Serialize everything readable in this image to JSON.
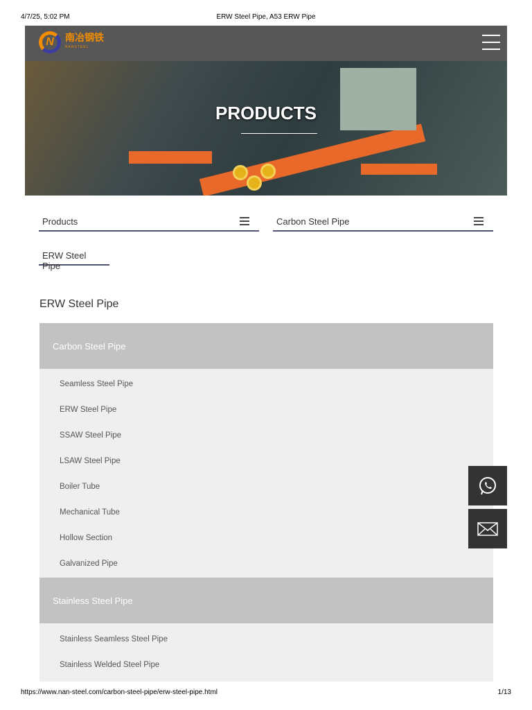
{
  "print_header": {
    "datetime": "4/7/25, 5:02 PM",
    "title": "ERW Steel Pipe, A53 ERW Pipe"
  },
  "print_footer": {
    "url": "https://www.nan-steel.com/carbon-steel-pipe/erw-steel-pipe.html",
    "page": "1/13"
  },
  "logo": {
    "cn": "南冶钢铁",
    "en": "NANSTEEL",
    "mark": "N"
  },
  "banner": {
    "title": "PRODUCTS"
  },
  "selectors": [
    {
      "label": "Products"
    },
    {
      "label": "Carbon Steel Pipe"
    }
  ],
  "current_tab": "ERW Steel Pipe",
  "section_title": "ERW Steel Pipe",
  "categories": [
    {
      "name": "Carbon Steel Pipe",
      "items": [
        "Seamless Steel Pipe",
        "ERW Steel Pipe",
        "SSAW Steel Pipe",
        "LSAW Steel Pipe",
        "Boiler Tube",
        "Mechanical Tube",
        "Hollow Section",
        "Galvanized Pipe"
      ]
    },
    {
      "name": "Stainless Steel Pipe",
      "items": [
        "Stainless Seamless Steel Pipe",
        "Stainless Welded Steel Pipe"
      ]
    }
  ],
  "colors": {
    "header": "#575757",
    "accent": "#f28c00",
    "category": "#c2c2c2",
    "list": "#efefef"
  }
}
